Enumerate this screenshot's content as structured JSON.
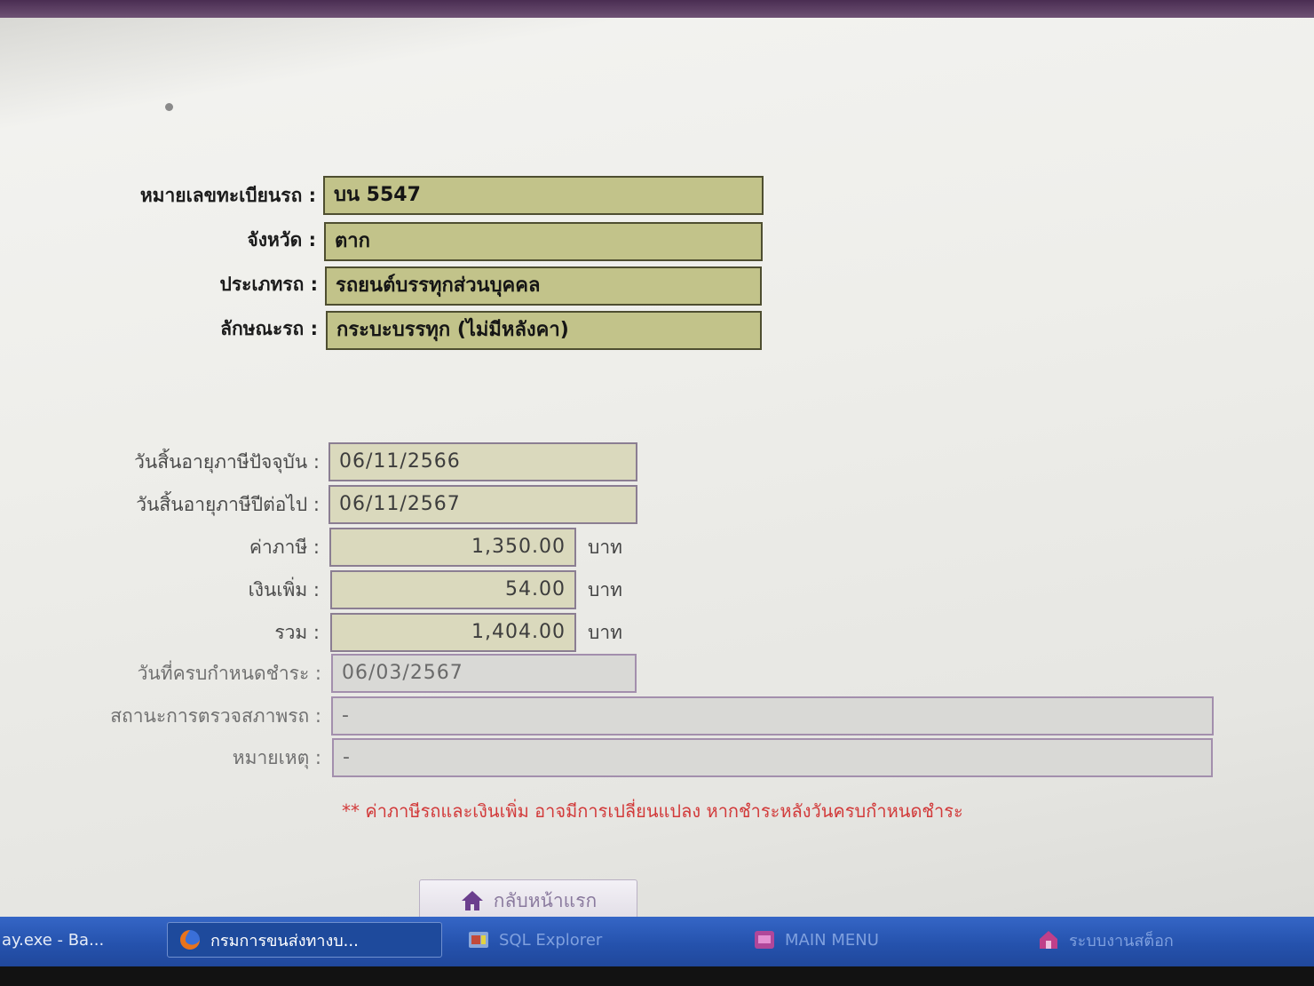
{
  "vehicle": {
    "plate_label": "หมายเลขทะเบียนรถ :",
    "plate_value": "บน 5547",
    "province_label": "จังหวัด :",
    "province_value": "ตาก",
    "type_label": "ประเภทรถ :",
    "type_value": "รถยนต์บรรทุกส่วนบุคคล",
    "style_label": "ลักษณะรถ :",
    "style_value": "กระบะบรรทุก (ไม่มีหลังคา)"
  },
  "tax": {
    "current_expiry_label": "วันสิ้นอายุภาษีปัจจุบัน :",
    "current_expiry_value": "06/11/2566",
    "next_expiry_label": "วันสิ้นอายุภาษีปีต่อไป :",
    "next_expiry_value": "06/11/2567",
    "tax_label": "ค่าภาษี :",
    "tax_value": "1,350.00",
    "surcharge_label": "เงินเพิ่ม :",
    "surcharge_value": "54.00",
    "total_label": "รวม :",
    "total_value": "1,404.00",
    "unit": "บาท",
    "due_label": "วันที่ครบกำหนดชำระ :",
    "due_value": "06/03/2567",
    "inspection_label": "สถานะการตรวจสภาพรถ :",
    "inspection_value": "-",
    "remark_label": "หมายเหตุ :",
    "remark_value": "-",
    "warning": "** ค่าภาษีรถและเงินเพิ่ม อาจมีการเปลี่ยนแปลง หากชำระหลังวันครบกำหนดชำระ"
  },
  "actions": {
    "home_label": "กลับหน้าแรก",
    "home_icon": "home-icon"
  },
  "taskbar": {
    "items": [
      {
        "label": "ay.exe - Ba...",
        "icon": "console-icon"
      },
      {
        "label": "กรมการขนส่งทางบ...",
        "icon": "firefox-icon"
      },
      {
        "label": "SQL Explorer",
        "icon": "sql-explorer-icon"
      },
      {
        "label": "MAIN MENU",
        "icon": "app-icon"
      },
      {
        "label": "ระบบงานสต็อก",
        "icon": "stock-icon"
      }
    ]
  },
  "colors": {
    "olive_field": "#c2c38a",
    "khaki_field": "#dad9bd",
    "warning_red": "#d23a3a",
    "taskbar_blue": "#2552ad"
  }
}
